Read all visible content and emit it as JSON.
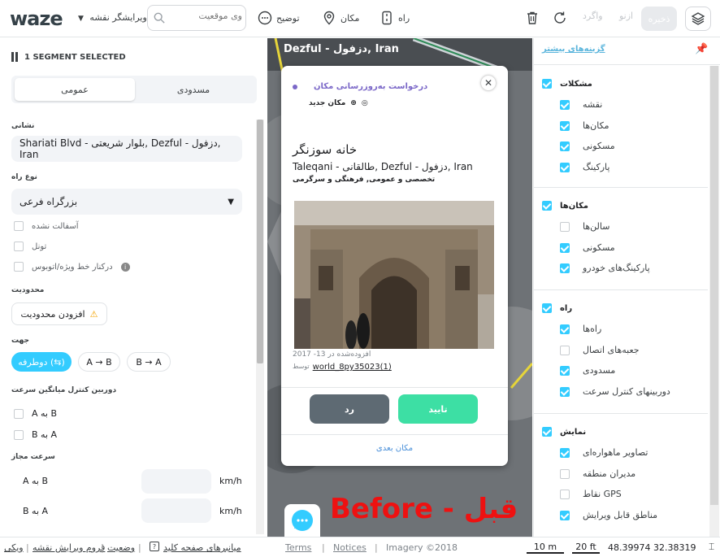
{
  "topbar": {
    "logo": "waze",
    "editor_menu": "ویرایشگر نقشه",
    "search_placeholder": "وی موقعیت",
    "tools": {
      "describe": "توضیح",
      "place": "مکان",
      "road": "راه",
      "redo": "واگرد",
      "undo": "ازنو",
      "save": "ذخیره"
    }
  },
  "segment": {
    "header": "1 SEGMENT SELECTED",
    "tabs": [
      "مسدودی",
      "عمومی"
    ],
    "address_label": "نشانی",
    "address_value": "Shariati Blvd - بلوار شریعتی, Dezful - دزفول, Iran",
    "road_type_label": "نوع راه",
    "road_type_value": "بزرگراه فرعی",
    "checks": [
      "آسفالت نشده",
      "تونل",
      "درکنار خط ویژه/اتوبوس"
    ],
    "restrictions_label": "محدودیت",
    "add_restriction": "افزودن محدودیت",
    "direction_label": "جهت",
    "directions": [
      "دوطرفه (⇆)",
      "A → B",
      "B → A"
    ],
    "avg_speed_label": "دوربین کنترل میانگین سرعت",
    "avg_speed_items": [
      "A به B",
      "B به A"
    ],
    "speed_limit_label": "سرعت مجاز",
    "speed_rows": [
      "A به B",
      "B به A"
    ],
    "unit": "km/h"
  },
  "map": {
    "title": "Dezful - دزفول, Iran",
    "overlay_text": "Before - قبل",
    "scale_m": "10 m",
    "scale_ft": "20 ft",
    "coords": "48.39974 32.38319"
  },
  "place_card": {
    "request_title": "درخواست به‌روزرسانی مکان",
    "new_place": "مکان جدید",
    "name": "خانه سوزنگر",
    "address": "Taleqani - طالقانی, Dezful - دزفول, Iran",
    "category": "تخصصی و عمومی, فرهنگی و سرگرمی",
    "added": "افزوده‌شده در 13- 2017",
    "by_prefix": "توسط",
    "by_user": "world_8py35023(1)",
    "reject": "رد",
    "approve": "تایید",
    "next": "مکان بعدی"
  },
  "layers": {
    "more_options": "گزینه‌های بیشتر",
    "groups": [
      {
        "title": "مشکلات",
        "on": true,
        "items": [
          {
            "label": "نقشه",
            "on": true
          },
          {
            "label": "مکان‌ها",
            "on": true
          },
          {
            "label": "مسکونی",
            "on": true
          },
          {
            "label": "پارکینگ",
            "on": true
          }
        ]
      },
      {
        "title": "مکان‌ها",
        "on": true,
        "items": [
          {
            "label": "سالن‌ها",
            "on": false
          },
          {
            "label": "مسکونی",
            "on": true
          },
          {
            "label": "پارکینگ‌های خودرو",
            "on": true
          }
        ]
      },
      {
        "title": "راه",
        "on": true,
        "items": [
          {
            "label": "راه‌ها",
            "on": true
          },
          {
            "label": "جعبه‌های اتصال",
            "on": false
          },
          {
            "label": "مسدودی",
            "on": true
          },
          {
            "label": "دوربینهای کنترل سرعت",
            "on": true
          }
        ]
      },
      {
        "title": "نمایش",
        "on": true,
        "items": [
          {
            "label": "تصاویر ماهواره‌ای",
            "on": true
          },
          {
            "label": "مدیران منطقه",
            "on": false
          },
          {
            "label": "نقاط GPS",
            "on": false
          },
          {
            "label": "مناطق قابل ویرایش",
            "on": true
          }
        ]
      }
    ]
  },
  "footer": {
    "links": [
      "ویکی",
      "فروم ویرایش نقشه",
      "وضعیت",
      "میانبرهای صفحه کلید"
    ],
    "terms": "Terms",
    "notices": "Notices",
    "imagery": "Imagery ©2018"
  },
  "colors": {
    "accent": "#33ccff",
    "approve": "#3ddfa4",
    "reject": "#5e6a73",
    "overlay_red": "#e11111",
    "link_purple": "#7b68c8"
  }
}
